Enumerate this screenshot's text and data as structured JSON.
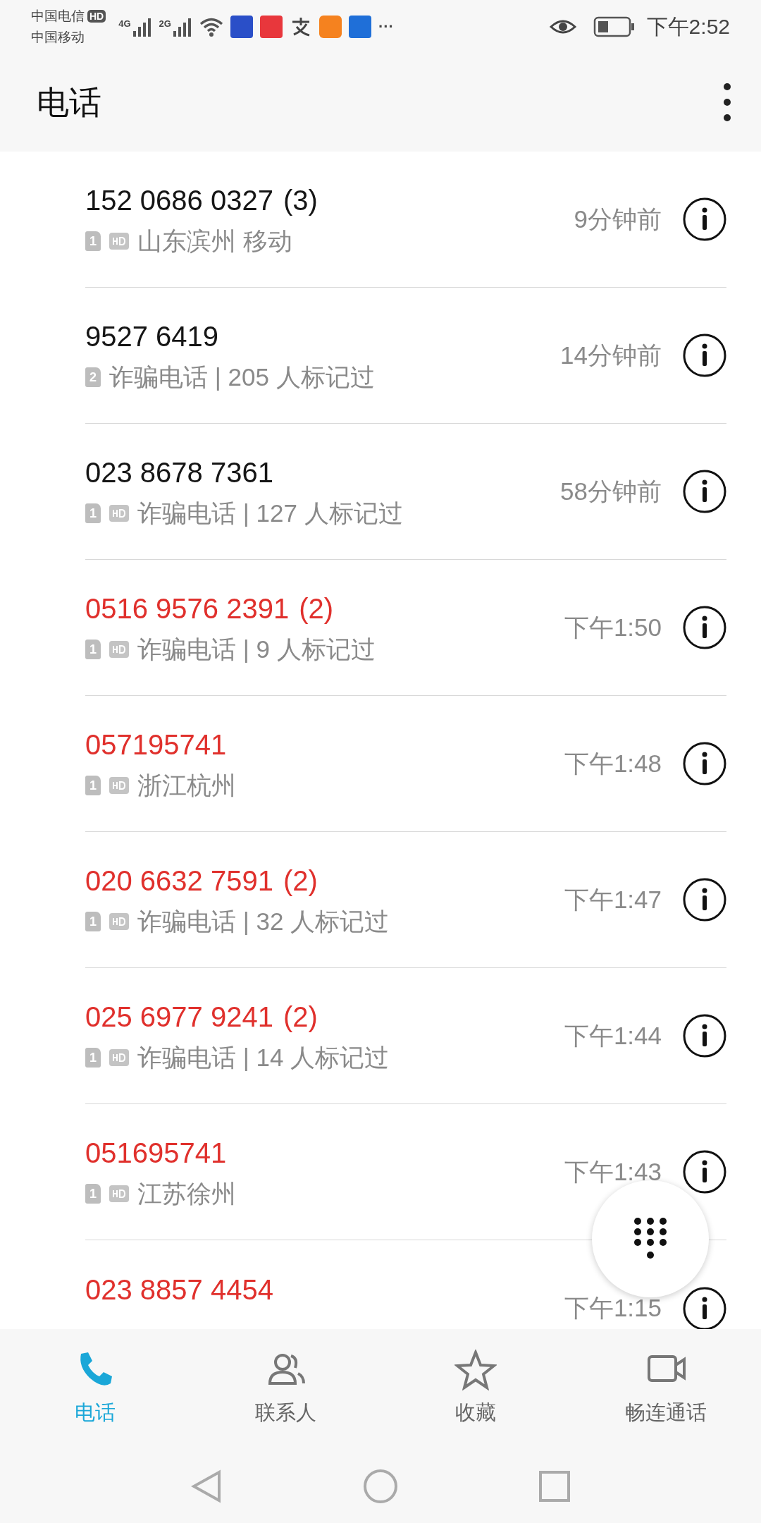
{
  "status_bar": {
    "carrier_1": "中国电信",
    "hd_badge": "HD",
    "carrier_2": "中国移动",
    "network_1": "4G",
    "network_2": "2G",
    "more": "···",
    "time": "下午2:52"
  },
  "app_bar": {
    "title": "电话"
  },
  "calls": [
    {
      "number": "152 0686 0327",
      "count": "(3)",
      "missed": false,
      "sim": "1",
      "hd": true,
      "detail": "山东滨州 移动",
      "time": "9分钟前"
    },
    {
      "number": "9527 6419",
      "missed": false,
      "sim": "2",
      "hd": false,
      "detail": "诈骗电话 | 205 人标记过",
      "time": "14分钟前"
    },
    {
      "number": "023 8678 7361",
      "missed": false,
      "sim": "1",
      "hd": true,
      "detail": "诈骗电话 | 127 人标记过",
      "time": "58分钟前"
    },
    {
      "number": "0516 9576 2391",
      "count": "(2)",
      "missed": true,
      "sim": "1",
      "hd": true,
      "detail": "诈骗电话 | 9 人标记过",
      "time": "下午1:50"
    },
    {
      "number": "057195741",
      "missed": true,
      "sim": "1",
      "hd": true,
      "detail": "浙江杭州",
      "time": "下午1:48"
    },
    {
      "number": "020 6632 7591",
      "count": "(2)",
      "missed": true,
      "sim": "1",
      "hd": true,
      "detail": "诈骗电话 | 32 人标记过",
      "time": "下午1:47"
    },
    {
      "number": "025 6977 9241",
      "count": "(2)",
      "missed": true,
      "sim": "1",
      "hd": true,
      "detail": "诈骗电话 | 14 人标记过",
      "time": "下午1:44"
    },
    {
      "number": "051695741",
      "missed": true,
      "sim": "1",
      "hd": true,
      "detail": "江苏徐州",
      "time": "下午1:43"
    },
    {
      "number": "023 8857 4454",
      "missed": true,
      "time": "下午1:15"
    }
  ],
  "tabs": [
    {
      "kind": "phone",
      "label": "电话",
      "selected": true
    },
    {
      "kind": "contacts",
      "label": "联系人",
      "selected": false
    },
    {
      "kind": "favorites",
      "label": "收藏",
      "selected": false
    },
    {
      "kind": "video",
      "label": "畅连通话",
      "selected": false
    }
  ]
}
